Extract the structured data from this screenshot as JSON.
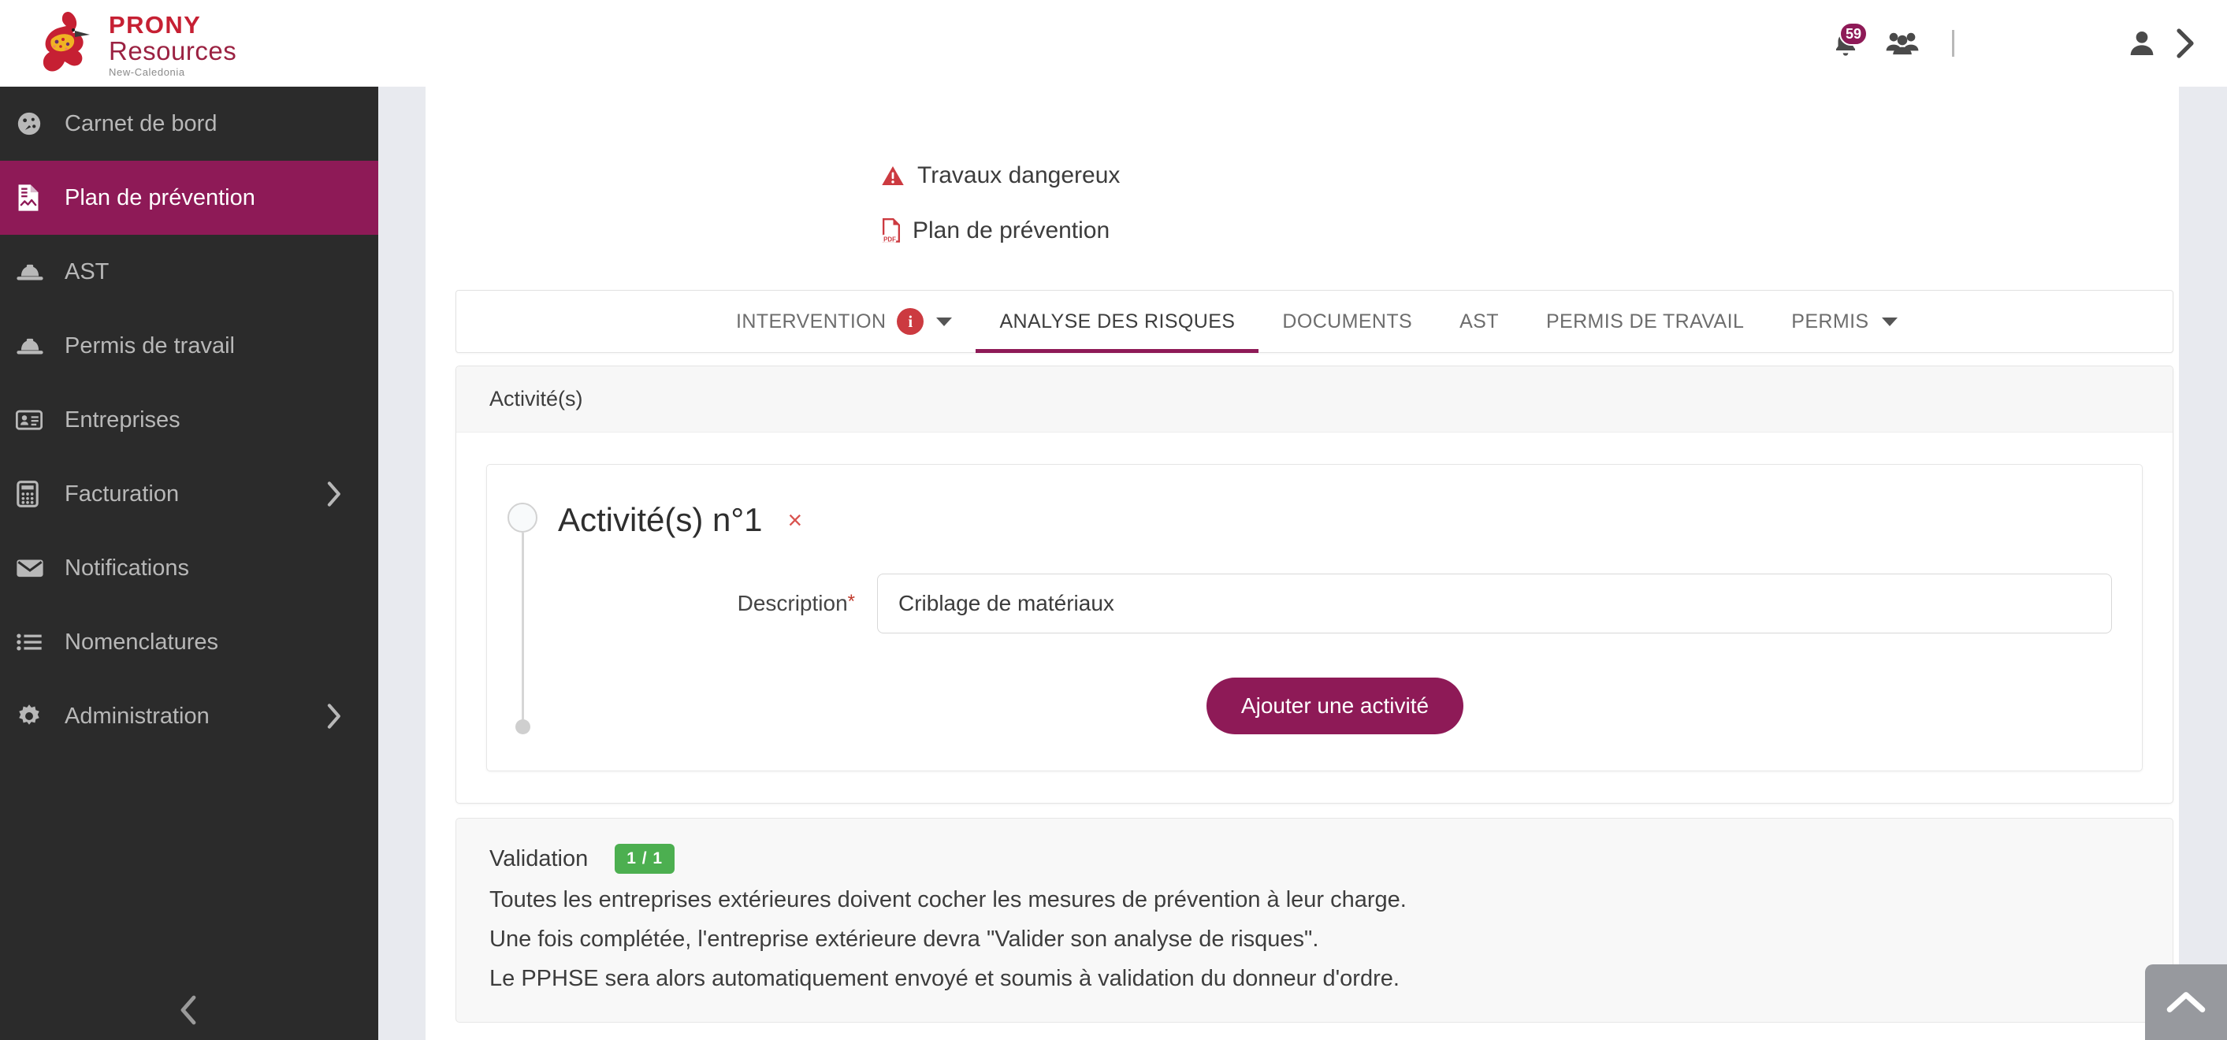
{
  "brand": {
    "name_line1": "PRONY",
    "name_line2": "Resources",
    "tagline": "New-Caledonia",
    "accent_purple": "#8e1a57",
    "accent_red": "#c62033",
    "sidebar_bg": "#2b2b2b"
  },
  "header": {
    "notifications_count": "59",
    "bell_icon": "bell-icon",
    "group_icon": "users-group-icon",
    "user_icon": "user-avatar-icon",
    "user_chevron_icon": "chevron-right-icon"
  },
  "sidebar": {
    "collapse_icon": "chevron-left-icon",
    "items": [
      {
        "label": "Carnet de bord",
        "icon": "dashboard-icon",
        "active": false,
        "has_submenu": false
      },
      {
        "label": "Plan de prévention",
        "icon": "file-doc-icon",
        "active": true,
        "has_submenu": false
      },
      {
        "label": "AST",
        "icon": "hard-hat-icon",
        "active": false,
        "has_submenu": false
      },
      {
        "label": "Permis de travail",
        "icon": "hard-hat-icon",
        "active": false,
        "has_submenu": false
      },
      {
        "label": "Entreprises",
        "icon": "id-card-icon",
        "active": false,
        "has_submenu": false
      },
      {
        "label": "Facturation",
        "icon": "calculator-icon",
        "active": false,
        "has_submenu": true
      },
      {
        "label": "Notifications",
        "icon": "envelope-icon",
        "active": false,
        "has_submenu": false
      },
      {
        "label": "Nomenclatures",
        "icon": "list-icon",
        "active": false,
        "has_submenu": false
      },
      {
        "label": "Administration",
        "icon": "gear-icon",
        "active": false,
        "has_submenu": true
      }
    ]
  },
  "breadcrumbs": {
    "danger_label": "Travaux dangereux",
    "danger_icon": "warning-triangle-icon",
    "pdf_label": "Plan de prévention",
    "pdf_icon": "pdf-file-icon"
  },
  "tabs": [
    {
      "label": "INTERVENTION",
      "active": false,
      "badge": "i",
      "caret": true
    },
    {
      "label": "ANALYSE DES RISQUES",
      "active": true,
      "badge": null,
      "caret": false
    },
    {
      "label": "DOCUMENTS",
      "active": false,
      "badge": null,
      "caret": false
    },
    {
      "label": "AST",
      "active": false,
      "badge": null,
      "caret": false
    },
    {
      "label": "PERMIS DE TRAVAIL",
      "active": false,
      "badge": null,
      "caret": false
    },
    {
      "label": "PERMIS",
      "active": false,
      "badge": null,
      "caret": true
    }
  ],
  "activity_panel": {
    "section_title": "Activité(s)",
    "activity_title": "Activité(s) n°1",
    "remove_label": "×",
    "description_label": "Description",
    "required_marker": "*",
    "description_value": "Criblage de matériaux",
    "description_placeholder": "Description",
    "add_button_label": "Ajouter une activité"
  },
  "validation": {
    "title": "Validation",
    "badge": "1 / 1",
    "badge_color": "#4caf50",
    "lines": [
      "Toutes les entreprises extérieures doivent cocher les mesures de prévention à leur charge.",
      "Une fois complétée, l'entreprise extérieure devra \"Valider son analyse de risques\".",
      "Le PPHSE sera alors automatiquement envoyé et soumis à validation du donneur d'ordre."
    ]
  },
  "scroll_top": {
    "icon": "chevron-up-icon"
  }
}
